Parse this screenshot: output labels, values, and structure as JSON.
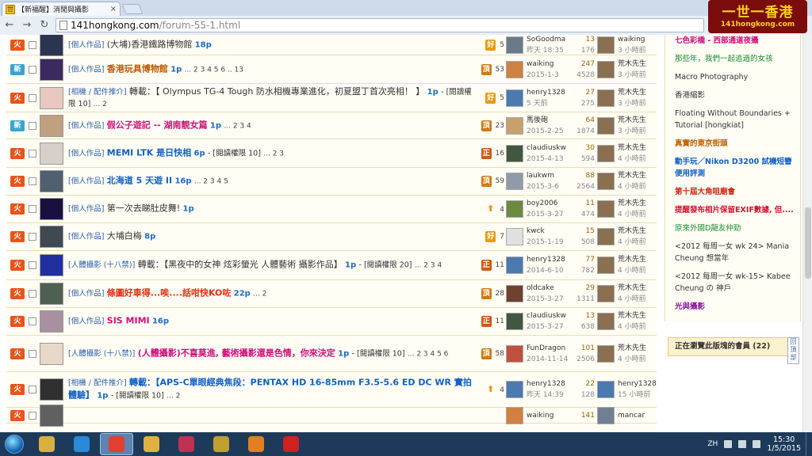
{
  "browser": {
    "tab_title": "【新福醒】消閒與攝影",
    "tab_close": "×",
    "back": "←",
    "forward": "→",
    "reload": "↻",
    "url_host": "141hongkong.com",
    "url_path": "/forum-55-1.html"
  },
  "logo": {
    "main": "一世一香港",
    "sub": "141hongkong.com"
  },
  "icon_labels": {
    "fire": "火",
    "new": "新"
  },
  "threads": [
    {
      "type": "fire",
      "cat": "[個人作品]",
      "title": "(大埔)香港鐵路博物館",
      "style": "",
      "pages": "18p",
      "perm": "",
      "nums": "",
      "badge": "好",
      "reward": "5",
      "author": "SoGoodma",
      "date": "昨天 18:35",
      "replies": "13",
      "views": "176",
      "last_user": "waiking",
      "last_time": "3 小時前",
      "thumb": "#2a3550",
      "av1": "#6a7a8a",
      "av2": "#8a7050"
    },
    {
      "type": "new",
      "cat": "[個人作品]",
      "title": "香港玩具博物館",
      "style": "orange",
      "pages": "1p",
      "perm": "",
      "nums": "... 2 3 4 5 6 .. 13",
      "badge": "頂",
      "reward": "53",
      "author": "waiking",
      "date": "2015-1-3",
      "replies": "247",
      "views": "4528",
      "last_user": "荒木先生",
      "last_time": "3 小時前",
      "thumb": "#3a2a60",
      "av1": "#d08040",
      "av2": "#8a7050"
    },
    {
      "type": "fire",
      "cat": "[相機 / 配件推介]",
      "title": "轉載：【 Olympus TG-4 Tough 防水相機專業進化，初夏盟丁首次亮相！ 】",
      "style": "",
      "pages": "1p",
      "perm": "- [閱讀權限 10]",
      "nums": "... 2",
      "badge": "好",
      "reward": "5",
      "author": "henry1328",
      "date": "5 天前",
      "replies": "27",
      "views": "275",
      "last_user": "荒木先生",
      "last_time": "3 小時前",
      "thumb": "#e8c8c0",
      "av1": "#4a7ab0",
      "av2": "#8a7050"
    },
    {
      "type": "new",
      "cat": "[個人作品]",
      "title": "假公子遊記 -- 湖南靚女篇",
      "style": "pink",
      "pages": "1p",
      "perm": "",
      "nums": "... 2 3 4",
      "badge": "頂",
      "reward": "23",
      "author": "馬後砲",
      "date": "2015-2-25",
      "replies": "64",
      "views": "1874",
      "last_user": "荒木先生",
      "last_time": "3 小時前",
      "thumb": "#c0a080",
      "av1": "#c8a070",
      "av2": "#8a7050"
    },
    {
      "type": "fire",
      "cat": "[個人作品]",
      "title": "MEMI LTK 是日快相",
      "style": "blue",
      "pages": "6p",
      "perm": "- [閱讀權限 10]",
      "nums": "... 2 3",
      "badge": "正",
      "reward": "16",
      "author": "claudiuskw",
      "date": "2015-4-13",
      "replies": "30",
      "views": "594",
      "last_user": "荒木先生",
      "last_time": "4 小時前",
      "thumb": "#d8d0c8",
      "av1": "#405840",
      "av2": "#8a7050"
    },
    {
      "type": "fire",
      "cat": "[個人作品]",
      "title": "北海道 5 天遊 II",
      "style": "blue",
      "pages": "16p",
      "perm": "",
      "nums": "... 2 3 4 5",
      "badge": "頂",
      "reward": "59",
      "author": "laukwm",
      "date": "2015-3-6",
      "replies": "88",
      "views": "2564",
      "last_user": "荒木先生",
      "last_time": "4 小時前",
      "thumb": "#506070",
      "av1": "#909aa8",
      "av2": "#8a7050"
    },
    {
      "type": "fire",
      "cat": "[個人作品]",
      "title": "第一次去睇肚皮舞!",
      "style": "",
      "pages": "1p",
      "perm": "",
      "nums": "",
      "badge": "arrow",
      "reward": "4",
      "author": "boy2006",
      "date": "2015-3-27",
      "replies": "11",
      "views": "474",
      "last_user": "荒木先生",
      "last_time": "4 小時前",
      "thumb": "#1a1040",
      "av1": "#6a8a40",
      "av2": "#8a7050"
    },
    {
      "type": "fire",
      "cat": "[個人作品]",
      "title": "大埔白梅",
      "style": "",
      "pages": "8p",
      "perm": "",
      "nums": "",
      "badge": "好",
      "reward": "7",
      "author": "kwck",
      "date": "2015-1-19",
      "replies": "15",
      "views": "508",
      "last_user": "荒木先生",
      "last_time": "4 小時前",
      "thumb": "#404850",
      "av1": "#e0e0e0",
      "av2": "#8a7050"
    },
    {
      "type": "fire",
      "cat": "[人體攝影 (十八禁)]",
      "title": "轉載：【黑夜中的女神 炫彩螢光 人體藝術 攝影作品】",
      "style": "",
      "pages": "1p",
      "perm": "- [閱讀權限 20]",
      "nums": "... 2 3 4",
      "badge": "正",
      "reward": "11",
      "author": "henry1328",
      "date": "2014-6-10",
      "replies": "77",
      "views": "782",
      "last_user": "荒木先生",
      "last_time": "4 小時前",
      "thumb": "#2030a0",
      "av1": "#4a7ab0",
      "av2": "#8a7050"
    },
    {
      "type": "fire",
      "cat": "[個人作品]",
      "title": "條圖好車得...唉....話咁快KO咗",
      "style": "red",
      "pages": "22p",
      "perm": "",
      "nums": "... 2",
      "badge": "頂",
      "reward": "28",
      "author": "oldcake",
      "date": "2015-3-27",
      "replies": "29",
      "views": "1311",
      "last_user": "荒木先生",
      "last_time": "4 小時前",
      "thumb": "#506050",
      "av1": "#704030",
      "av2": "#8a7050"
    },
    {
      "type": "fire",
      "cat": "[個人作品]",
      "title": "SIS MIMI",
      "style": "pink",
      "pages": "16p",
      "perm": "",
      "nums": "",
      "badge": "正",
      "reward": "11",
      "author": "claudiuskw",
      "date": "2015-3-27",
      "replies": "13",
      "views": "638",
      "last_user": "荒木先生",
      "last_time": "4 小時前",
      "thumb": "#a890a0",
      "av1": "#405840",
      "av2": "#8a7050"
    },
    {
      "type": "fire",
      "cat": "[人體攝影 (十八禁)]",
      "title": "(人體攝影)不喜莫進, 藝術攝影還是色情，你來決定",
      "style": "pink",
      "pages": "1p",
      "perm": "- [閱讀權限 10]",
      "nums": "... 2 3 4 5 6",
      "badge": "頂",
      "reward": "58",
      "author": "FunDragon",
      "date": "2014-11-14",
      "replies": "101",
      "views": "2506",
      "last_user": "荒木先生",
      "last_time": "4 小時前",
      "thumb": "#e8d8c8",
      "av1": "#c05040",
      "av2": "#8a7050"
    },
    {
      "type": "fire",
      "cat": "[相機 / 配件推介]",
      "title": "轉載：【APS-C單眼經典焦段：PENTAX HD 16-85mm F3.5-5.6 ED DC WR 實拍體驗】",
      "style": "blue",
      "pages": "1p",
      "perm": "- [閱讀權限 10]",
      "nums": "... 2",
      "badge": "arrow",
      "reward": "4",
      "author": "henry1328",
      "date": "昨天 14:39",
      "replies": "22",
      "views": "128",
      "last_user": "henry1328",
      "last_time": "15 小時前",
      "thumb": "#303030",
      "av1": "#4a7ab0",
      "av2": "#4a7ab0"
    },
    {
      "type": "fire",
      "cat": "",
      "title": "",
      "style": "",
      "pages": "",
      "perm": "",
      "nums": "",
      "badge": "",
      "reward": "",
      "author": "waiking",
      "date": "",
      "replies": "141",
      "views": "",
      "last_user": "mancar",
      "last_time": "",
      "thumb": "#606060",
      "av1": "#d08040",
      "av2": "#708090"
    }
  ],
  "sidebar": {
    "items": [
      {
        "text": "七色彩橋 - 西部通道夜攝",
        "style": "pink"
      },
      {
        "text": "那些年，我們一起追過的女孩",
        "style": "green"
      },
      {
        "text": "Macro Photography",
        "style": "gray"
      },
      {
        "text": "香港縮影",
        "style": "gray"
      },
      {
        "text": "Floating Without Boundaries + Tutorial [hongkiat]",
        "style": "gray"
      },
      {
        "text": "真實的東京街頭",
        "style": "orange"
      },
      {
        "text": "動手玩／Nikon D3200 試機短簪便用評測",
        "style": "blue"
      },
      {
        "text": "第十屆大角咀廟會",
        "style": "red"
      },
      {
        "text": "提醒發布相片保留EXIF數據, 但....",
        "style": "crimson"
      },
      {
        "text": "原來外國D龍友仲勁",
        "style": "green"
      },
      {
        "text": "<2012 每周一女 wk 24> Mania Cheung 想當年",
        "style": "gray"
      },
      {
        "text": "<2012 每周一女 wk-15> Kabee Cheung の 神戶",
        "style": "gray"
      },
      {
        "text": "光與攝影",
        "style": "purple"
      }
    ],
    "members": "正在瀏覽此版塊的會員 (22)",
    "backtop": "回頂部"
  },
  "taskbar": {
    "apps": [
      {
        "name": "explorer-window",
        "color": "#d8b040",
        "active": false
      },
      {
        "name": "internet-explorer",
        "color": "#2a8ad8",
        "active": false
      },
      {
        "name": "chrome",
        "color": "#e04030",
        "active": true
      },
      {
        "name": "file-explorer",
        "color": "#e0b040",
        "active": false
      },
      {
        "name": "folder-app",
        "color": "#c03050",
        "active": false
      },
      {
        "name": "color-app",
        "color": "#c0a030",
        "active": false
      },
      {
        "name": "media-player",
        "color": "#e08020",
        "active": false
      },
      {
        "name": "pulse-app",
        "color": "#d02020",
        "active": false
      }
    ],
    "lang": "ZH",
    "time": "15:30",
    "date": "1/5/2015"
  },
  "colors": {
    "accent": "#e8541c",
    "link": "#1a6bc8",
    "row_bg": "#fffdf4"
  }
}
